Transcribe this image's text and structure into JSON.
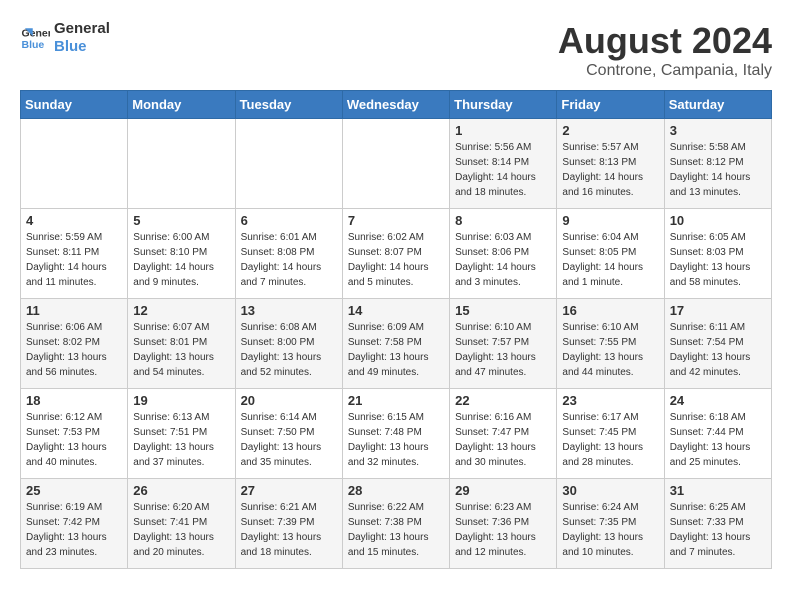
{
  "logo": {
    "line1": "General",
    "line2": "Blue"
  },
  "title": "August 2024",
  "subtitle": "Controne, Campania, Italy",
  "days_of_week": [
    "Sunday",
    "Monday",
    "Tuesday",
    "Wednesday",
    "Thursday",
    "Friday",
    "Saturday"
  ],
  "weeks": [
    [
      {
        "day": "",
        "info": ""
      },
      {
        "day": "",
        "info": ""
      },
      {
        "day": "",
        "info": ""
      },
      {
        "day": "",
        "info": ""
      },
      {
        "day": "1",
        "info": "Sunrise: 5:56 AM\nSunset: 8:14 PM\nDaylight: 14 hours\nand 18 minutes."
      },
      {
        "day": "2",
        "info": "Sunrise: 5:57 AM\nSunset: 8:13 PM\nDaylight: 14 hours\nand 16 minutes."
      },
      {
        "day": "3",
        "info": "Sunrise: 5:58 AM\nSunset: 8:12 PM\nDaylight: 14 hours\nand 13 minutes."
      }
    ],
    [
      {
        "day": "4",
        "info": "Sunrise: 5:59 AM\nSunset: 8:11 PM\nDaylight: 14 hours\nand 11 minutes."
      },
      {
        "day": "5",
        "info": "Sunrise: 6:00 AM\nSunset: 8:10 PM\nDaylight: 14 hours\nand 9 minutes."
      },
      {
        "day": "6",
        "info": "Sunrise: 6:01 AM\nSunset: 8:08 PM\nDaylight: 14 hours\nand 7 minutes."
      },
      {
        "day": "7",
        "info": "Sunrise: 6:02 AM\nSunset: 8:07 PM\nDaylight: 14 hours\nand 5 minutes."
      },
      {
        "day": "8",
        "info": "Sunrise: 6:03 AM\nSunset: 8:06 PM\nDaylight: 14 hours\nand 3 minutes."
      },
      {
        "day": "9",
        "info": "Sunrise: 6:04 AM\nSunset: 8:05 PM\nDaylight: 14 hours\nand 1 minute."
      },
      {
        "day": "10",
        "info": "Sunrise: 6:05 AM\nSunset: 8:03 PM\nDaylight: 13 hours\nand 58 minutes."
      }
    ],
    [
      {
        "day": "11",
        "info": "Sunrise: 6:06 AM\nSunset: 8:02 PM\nDaylight: 13 hours\nand 56 minutes."
      },
      {
        "day": "12",
        "info": "Sunrise: 6:07 AM\nSunset: 8:01 PM\nDaylight: 13 hours\nand 54 minutes."
      },
      {
        "day": "13",
        "info": "Sunrise: 6:08 AM\nSunset: 8:00 PM\nDaylight: 13 hours\nand 52 minutes."
      },
      {
        "day": "14",
        "info": "Sunrise: 6:09 AM\nSunset: 7:58 PM\nDaylight: 13 hours\nand 49 minutes."
      },
      {
        "day": "15",
        "info": "Sunrise: 6:10 AM\nSunset: 7:57 PM\nDaylight: 13 hours\nand 47 minutes."
      },
      {
        "day": "16",
        "info": "Sunrise: 6:10 AM\nSunset: 7:55 PM\nDaylight: 13 hours\nand 44 minutes."
      },
      {
        "day": "17",
        "info": "Sunrise: 6:11 AM\nSunset: 7:54 PM\nDaylight: 13 hours\nand 42 minutes."
      }
    ],
    [
      {
        "day": "18",
        "info": "Sunrise: 6:12 AM\nSunset: 7:53 PM\nDaylight: 13 hours\nand 40 minutes."
      },
      {
        "day": "19",
        "info": "Sunrise: 6:13 AM\nSunset: 7:51 PM\nDaylight: 13 hours\nand 37 minutes."
      },
      {
        "day": "20",
        "info": "Sunrise: 6:14 AM\nSunset: 7:50 PM\nDaylight: 13 hours\nand 35 minutes."
      },
      {
        "day": "21",
        "info": "Sunrise: 6:15 AM\nSunset: 7:48 PM\nDaylight: 13 hours\nand 32 minutes."
      },
      {
        "day": "22",
        "info": "Sunrise: 6:16 AM\nSunset: 7:47 PM\nDaylight: 13 hours\nand 30 minutes."
      },
      {
        "day": "23",
        "info": "Sunrise: 6:17 AM\nSunset: 7:45 PM\nDaylight: 13 hours\nand 28 minutes."
      },
      {
        "day": "24",
        "info": "Sunrise: 6:18 AM\nSunset: 7:44 PM\nDaylight: 13 hours\nand 25 minutes."
      }
    ],
    [
      {
        "day": "25",
        "info": "Sunrise: 6:19 AM\nSunset: 7:42 PM\nDaylight: 13 hours\nand 23 minutes."
      },
      {
        "day": "26",
        "info": "Sunrise: 6:20 AM\nSunset: 7:41 PM\nDaylight: 13 hours\nand 20 minutes."
      },
      {
        "day": "27",
        "info": "Sunrise: 6:21 AM\nSunset: 7:39 PM\nDaylight: 13 hours\nand 18 minutes."
      },
      {
        "day": "28",
        "info": "Sunrise: 6:22 AM\nSunset: 7:38 PM\nDaylight: 13 hours\nand 15 minutes."
      },
      {
        "day": "29",
        "info": "Sunrise: 6:23 AM\nSunset: 7:36 PM\nDaylight: 13 hours\nand 12 minutes."
      },
      {
        "day": "30",
        "info": "Sunrise: 6:24 AM\nSunset: 7:35 PM\nDaylight: 13 hours\nand 10 minutes."
      },
      {
        "day": "31",
        "info": "Sunrise: 6:25 AM\nSunset: 7:33 PM\nDaylight: 13 hours\nand 7 minutes."
      }
    ]
  ]
}
